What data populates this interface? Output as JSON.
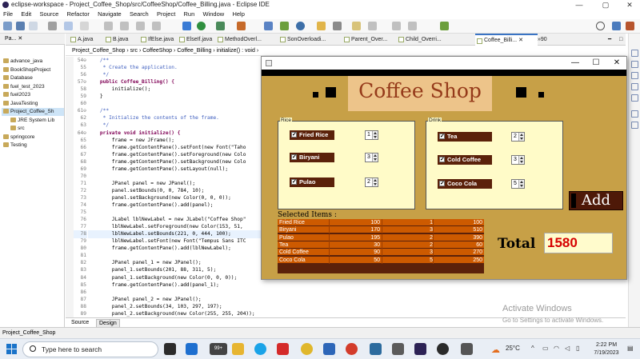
{
  "window": {
    "title": "eclipse-workspace - Project_Coffee_Shop/src/CoffeeShop/Coffee_Billing.java - Eclipse IDE",
    "minimize": "—",
    "maximize": "▢",
    "close": "✕"
  },
  "menu": [
    "File",
    "Edit",
    "Source",
    "Refactor",
    "Navigate",
    "Search",
    "Project",
    "Run",
    "Window",
    "Help"
  ],
  "package_explorer": {
    "tab_label": "Pa...",
    "items": [
      {
        "label": "advance_java",
        "indent": 0
      },
      {
        "label": "BookShopProject",
        "indent": 0
      },
      {
        "label": "Database",
        "indent": 0
      },
      {
        "label": "fuel_test_2023",
        "indent": 0
      },
      {
        "label": "fuel2023",
        "indent": 0
      },
      {
        "label": "JavaTesting",
        "indent": 0
      },
      {
        "label": "Project_Coffee_Sh",
        "indent": 0
      },
      {
        "label": "JRE System Lib",
        "indent": 1
      },
      {
        "label": "src",
        "indent": 1
      },
      {
        "label": "springcore",
        "indent": 0
      },
      {
        "label": "Testing",
        "indent": 0
      }
    ]
  },
  "editor": {
    "tabs": [
      "A.java",
      "B.java",
      "IfElse.java",
      "ElseIf.java",
      "MethodOverl...",
      "SonOverloadi...",
      "Parent_Over...",
      "Child_Overri...",
      "Coffee_Billi...",
      "»90"
    ],
    "active_tab": "Coffee_Billi...",
    "breadcrumb": [
      "Project_Coffee_Shop",
      "src",
      "CoffeeShop",
      "Coffee_Billing",
      "initialize() : void"
    ],
    "line_numbers": [
      "54⊖",
      "55",
      "56",
      "57⊖",
      "58",
      "59",
      "60",
      "61⊖",
      "62",
      "63",
      "64⊖",
      "65",
      "66",
      "67",
      "68",
      "69",
      "70",
      "71",
      "72",
      "73",
      "74",
      "75",
      "76",
      "77",
      "78",
      "79",
      "80",
      "81",
      "82",
      "83",
      "84",
      "85",
      "86",
      "87",
      "88",
      "89"
    ],
    "code_lines": [
      {
        "text": "    /**",
        "style": "comment"
      },
      {
        "text": "     * Create the application.",
        "style": "comment"
      },
      {
        "text": "     */",
        "style": "comment"
      },
      {
        "text": "    public Coffee_Billing() {",
        "style": "kw"
      },
      {
        "text": "        initialize();",
        "style": ""
      },
      {
        "text": "    }",
        "style": ""
      },
      {
        "text": "",
        "style": ""
      },
      {
        "text": "    /**",
        "style": "comment"
      },
      {
        "text": "     * Initialize the contents of the frame.",
        "style": "comment"
      },
      {
        "text": "     */",
        "style": "comment"
      },
      {
        "text": "    private void initialize() {",
        "style": "kw"
      },
      {
        "text": "        frame = new JFrame();",
        "style": ""
      },
      {
        "text": "        frame.getContentPane().setFont(new Font(\"Taho",
        "style": ""
      },
      {
        "text": "        frame.getContentPane().setForeground(new Colo",
        "style": ""
      },
      {
        "text": "        frame.getContentPane().setBackground(new Colo",
        "style": ""
      },
      {
        "text": "        frame.getContentPane().setLayout(null);",
        "style": ""
      },
      {
        "text": "",
        "style": ""
      },
      {
        "text": "        JPanel panel = new JPanel();",
        "style": ""
      },
      {
        "text": "        panel.setBounds(0, 0, 784, 10);",
        "style": ""
      },
      {
        "text": "        panel.setBackground(new Color(0, 0, 0));",
        "style": ""
      },
      {
        "text": "        frame.getContentPane().add(panel);",
        "style": ""
      },
      {
        "text": "",
        "style": ""
      },
      {
        "text": "        JLabel lblNewLabel = new JLabel(\"Coffee Shop\"",
        "style": ""
      },
      {
        "text": "        lblNewLabel.setForeground(new Color(153, 51,",
        "style": ""
      },
      {
        "text": "        lblNewLabel.setBounds(221, 0, 444, 100);",
        "style": ""
      },
      {
        "text": "        lblNewLabel.setFont(new Font(\"Tempus Sans ITC",
        "style": ""
      },
      {
        "text": "        frame.getContentPane().add(lblNewLabel);",
        "style": ""
      },
      {
        "text": "",
        "style": ""
      },
      {
        "text": "        JPanel panel_1 = new JPanel();",
        "style": ""
      },
      {
        "text": "        panel_1.setBounds(201, 88, 311, 5);",
        "style": ""
      },
      {
        "text": "        panel_1.setBackground(new Color(0, 0, 0));",
        "style": ""
      },
      {
        "text": "        frame.getContentPane().add(panel_1);",
        "style": ""
      },
      {
        "text": "",
        "style": ""
      },
      {
        "text": "        JPanel panel_2 = new JPanel();",
        "style": ""
      },
      {
        "text": "        panel_2.setBounds(34, 103, 297, 197);",
        "style": ""
      },
      {
        "text": "        panel_2.setBackground(new Color(255, 255, 204));",
        "style": ""
      }
    ],
    "highlighted_line": 24,
    "bottom_tabs": [
      "Source",
      "Design"
    ]
  },
  "status_bar": "Project_Coffee_Shop",
  "watermark": {
    "line1": "Activate Windows",
    "line2": "Go to Settings to activate Windows."
  },
  "coffee_app": {
    "window_controls": {
      "minimize": "—",
      "maximize": "☐",
      "close": "✕"
    },
    "title": "Coffee Shop",
    "rice_group": {
      "label": "Rice",
      "items": [
        {
          "name": "Fried Rice",
          "qty": "1"
        },
        {
          "name": "Biryani",
          "qty": "3"
        },
        {
          "name": "Pulao",
          "qty": "2"
        }
      ]
    },
    "drink_group": {
      "label": "Drink",
      "items": [
        {
          "name": "Tea",
          "qty": "2"
        },
        {
          "name": "Cold Coffee",
          "qty": "3"
        },
        {
          "name": "Coco Cola",
          "qty": "5"
        }
      ]
    },
    "add_button": "Add",
    "selected_label": "Selected Items :",
    "selected_items": [
      {
        "item": "Fried Rice",
        "price": "100",
        "qty": "1",
        "amount": "100"
      },
      {
        "item": "Biryani",
        "price": "170",
        "qty": "3",
        "amount": "510"
      },
      {
        "item": "Pulao",
        "price": "195",
        "qty": "2",
        "amount": "390"
      },
      {
        "item": "Tea",
        "price": "30",
        "qty": "2",
        "amount": "60"
      },
      {
        "item": "Cold Coffee",
        "price": "90",
        "qty": "3",
        "amount": "270"
      },
      {
        "item": "Coco Cola",
        "price": "50",
        "qty": "5",
        "amount": "250"
      }
    ],
    "total_label": "Total",
    "total_value": "1580"
  },
  "taskbar": {
    "search_placeholder": "Type here to search",
    "weather": "25°C",
    "time": "2:22 PM",
    "date": "7/19/2023",
    "badge": "99+"
  }
}
